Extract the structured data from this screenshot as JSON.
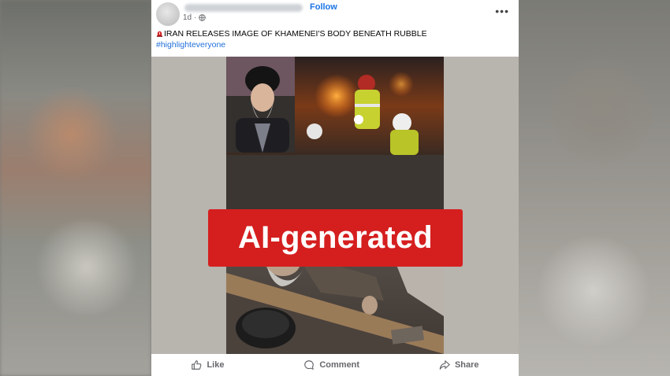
{
  "post": {
    "follow_label": "Follow",
    "time": "1d",
    "time_separator": "·",
    "title": "IRAN RELEASES IMAGE OF KHAMENEI'S BODY BENEATH RUBBLE",
    "hashtag": "#highlighteveryone"
  },
  "overlay": {
    "label": "AI-generated"
  },
  "actions": {
    "like": "Like",
    "comment": "Comment",
    "share": "Share"
  },
  "icons": {
    "avatar": "avatar",
    "globe": "globe-icon",
    "more": "more-options-icon",
    "alert": "red-alert-icon",
    "like": "thumbs-up-icon",
    "comment": "comment-bubble-icon",
    "share": "share-arrow-icon"
  },
  "colors": {
    "follow": "#1b74e4",
    "hashtag": "#216fdb",
    "label_bg": "#d51f1f",
    "action_text": "#65676b"
  }
}
